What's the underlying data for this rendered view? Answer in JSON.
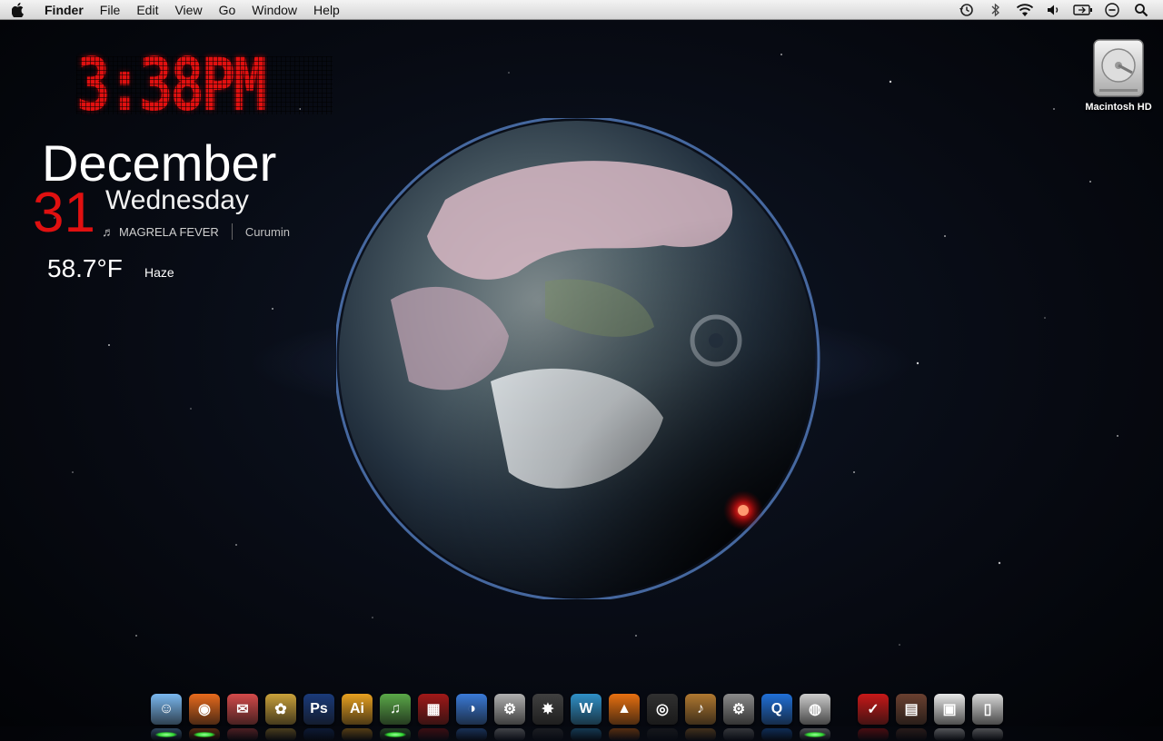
{
  "menubar": {
    "apple_icon": "apple-logo",
    "items": [
      "Finder",
      "File",
      "Edit",
      "View",
      "Go",
      "Window",
      "Help"
    ],
    "status_icons": [
      "time-machine-icon",
      "bluetooth-icon",
      "wifi-icon",
      "volume-icon",
      "battery-icon",
      "sync-icon",
      "spotlight-icon"
    ]
  },
  "widget": {
    "time": "3:38PM",
    "month": "December",
    "day": "31",
    "weekday": "Wednesday",
    "track": "MAGRELA FEVER",
    "artist": "Curumin",
    "temperature": "58.7°F",
    "condition": "Haze"
  },
  "desktop": {
    "drive_label": "Macintosh HD"
  },
  "dock": {
    "apps": [
      {
        "name": "finder",
        "glyph": "☺",
        "color": "#7ab8f0",
        "running": true
      },
      {
        "name": "firefox",
        "glyph": "◉",
        "color": "#e86a1c",
        "running": true
      },
      {
        "name": "mail",
        "glyph": "✉",
        "color": "#d44a4a",
        "running": false
      },
      {
        "name": "adium",
        "glyph": "✿",
        "color": "#c9a13a",
        "running": false
      },
      {
        "name": "photoshop",
        "glyph": "Ps",
        "color": "#1a3a7a",
        "running": false
      },
      {
        "name": "illustrator",
        "glyph": "Ai",
        "color": "#e8a020",
        "running": false
      },
      {
        "name": "itunes",
        "glyph": "♫",
        "color": "#5aa848",
        "running": true
      },
      {
        "name": "photo-booth",
        "glyph": "▦",
        "color": "#a01818",
        "running": false
      },
      {
        "name": "ichat",
        "glyph": "◑",
        "color": "#3a7ad8",
        "running": false
      },
      {
        "name": "automator",
        "glyph": "⚙",
        "color": "#b0b0b0",
        "running": false
      },
      {
        "name": "imovie",
        "glyph": "✸",
        "color": "#404040",
        "running": false
      },
      {
        "name": "dreamweaver",
        "glyph": "W",
        "color": "#2f90c8",
        "running": false
      },
      {
        "name": "vlc",
        "glyph": "▲",
        "color": "#e87010",
        "running": false
      },
      {
        "name": "camera",
        "glyph": "◎",
        "color": "#303030",
        "running": false
      },
      {
        "name": "garageband",
        "glyph": "♪",
        "color": "#b07830",
        "running": false
      },
      {
        "name": "system-preferences",
        "glyph": "⚙",
        "color": "#8a8a8a",
        "running": false
      },
      {
        "name": "quicktime",
        "glyph": "Q",
        "color": "#2070d8",
        "running": false
      },
      {
        "name": "dvd-player",
        "glyph": "◍",
        "color": "#cccccc",
        "running": true
      }
    ],
    "stacks": [
      {
        "name": "stack-nike",
        "glyph": "✓",
        "color": "#c81818"
      },
      {
        "name": "stack-pictures",
        "glyph": "▤",
        "color": "#6a4030"
      },
      {
        "name": "stack-downloads",
        "glyph": "▣",
        "color": "#e8e8e8"
      },
      {
        "name": "trash",
        "glyph": "▯",
        "color": "#d8d8d8"
      }
    ]
  }
}
